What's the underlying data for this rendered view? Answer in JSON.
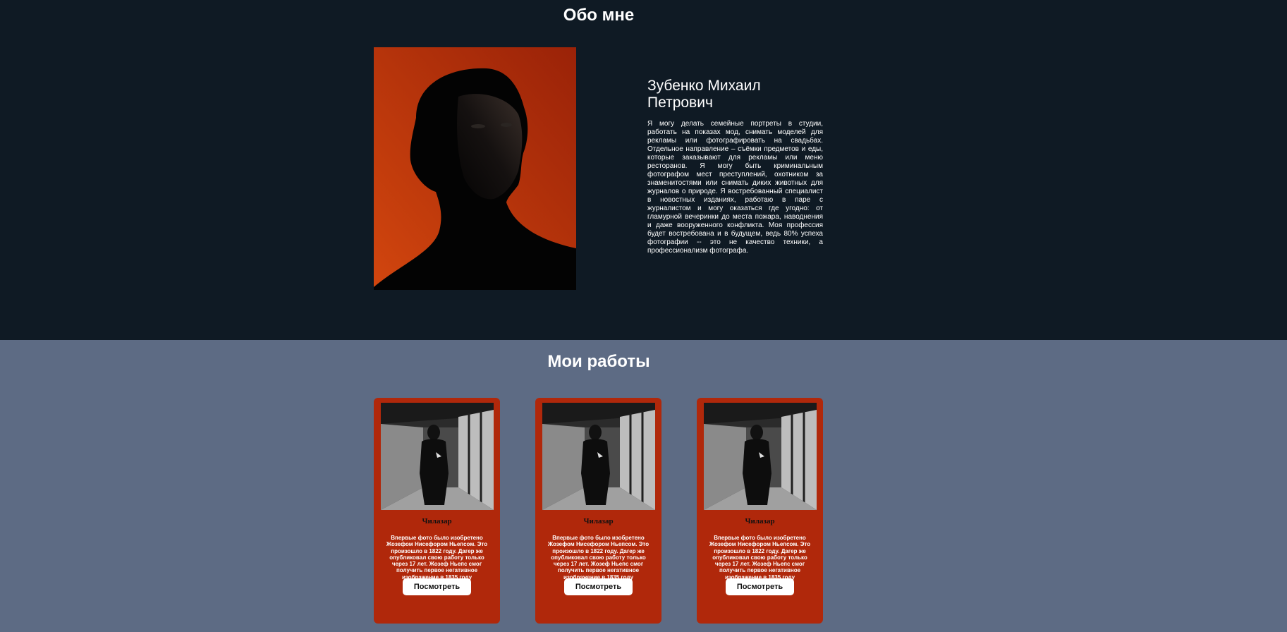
{
  "about": {
    "title": "Обо мне",
    "name": "Зубенко Михаил Петрович",
    "bio": "Я могу делать семейные портреты в студии, работать на показах мод, снимать моделей для рекламы или фотографировать на свадьбах. Отдельное направление – съёмки предметов и еды, которые заказывают для рекламы или меню ресторанов. Я могу быть криминальным фотографом мест преступлений, охотником за знаменитостями или снимать диких животных для журналов о природе. Я востребованный специалист в новостных изданиях, работаю в паре с журналистом и могу оказаться где угодно: от гламурной вечеринки до места пожара, наводнения и даже вооруженного конфликта. Моя профессия будет востребована и в будущем, ведь 80% успеха фотографии -- это не качество техники, а профессионализм фотографа.",
    "portrait_bg": "#c73b0c"
  },
  "works": {
    "title": "Мои работы",
    "cards": [
      {
        "title": "Чилазар",
        "text": "Впервые фото было изобретено Жозефом Нисефором Ньепсом. Это произошло в 1822 году. Дагер же опубликовал свою работу только через 17 лет. Жозеф Ньепс смог получить первое негативное изображение в 1835 году",
        "button": "Посмотреть"
      },
      {
        "title": "Чилазар",
        "text": "Впервые фото было изобретено Жозефом Нисефором Ньепсом. Это произошло в 1822 году. Дагер же опубликовал свою работу только через 17 лет. Жозеф Ньепс смог получить первое негативное изображение в 1835 году",
        "button": "Посмотреть"
      },
      {
        "title": "Чилазар",
        "text": "Впервые фото было изобретено Жозефом Нисефором Ньепсом. Это произошло в 1822 году. Дагер же опубликовал свою работу только через 17 лет. Жозеф Ньепс смог получить первое негативное изображение в 1835 году",
        "button": "Посмотреть"
      }
    ]
  },
  "colors": {
    "about_bg": "#0f1a24",
    "works_bg": "#5d6b84",
    "card_bg": "#b0280b"
  }
}
